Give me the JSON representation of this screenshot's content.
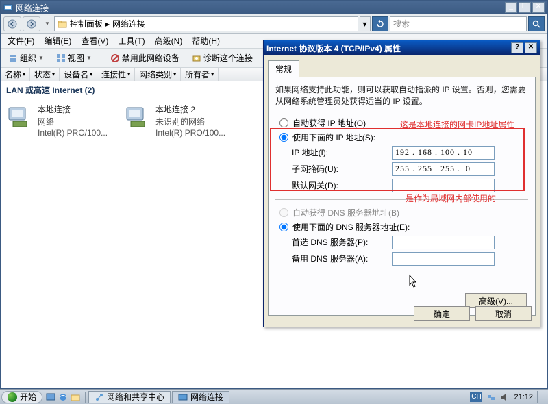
{
  "window": {
    "title": "网络连接",
    "breadcrumb_cp": "控制面板",
    "breadcrumb_nc": "网络连接",
    "search_placeholder": "搜索"
  },
  "menubar": {
    "file": "文件(F)",
    "edit": "编辑(E)",
    "view": "查看(V)",
    "tools": "工具(T)",
    "advanced": "高级(N)",
    "help": "帮助(H)"
  },
  "toolbar": {
    "organize": "组织",
    "views": "视图",
    "disable": "禁用此网络设备",
    "diagnose": "诊断这个连接"
  },
  "columns": [
    "名称",
    "状态",
    "设备名",
    "连接性",
    "网络类别",
    "所有者"
  ],
  "group_label": "LAN 或高速 Internet (2)",
  "connections": [
    {
      "name": "本地连接",
      "sub1": "网络",
      "sub2": "Intel(R) PRO/100..."
    },
    {
      "name": "本地连接 2",
      "sub1": "未识别的网络",
      "sub2": "Intel(R) PRO/100..."
    }
  ],
  "dialog": {
    "title": "Internet 协议版本 4 (TCP/IPv4) 属性",
    "tab_general": "常规",
    "desc": "如果网络支持此功能，则可以获取自动指派的 IP 设置。否则，您需要从网络系统管理员处获得适当的 IP 设置。",
    "radio_auto_ip": "自动获得 IP 地址(O)",
    "radio_manual_ip": "使用下面的 IP 地址(S):",
    "label_ip": "IP 地址(I):",
    "label_mask": "子网掩码(U):",
    "label_gw": "默认网关(D):",
    "val_ip": "192 . 168 . 100 . 10",
    "val_mask": "255 . 255 . 255 .  0",
    "val_gw": "",
    "radio_auto_dns": "自动获得 DNS 服务器地址(B)",
    "radio_manual_dns": "使用下面的 DNS 服务器地址(E):",
    "label_dns1": "首选 DNS 服务器(P):",
    "label_dns2": "备用 DNS 服务器(A):",
    "val_dns1": "",
    "val_dns2": "",
    "btn_adv": "高级(V)...",
    "btn_ok": "确定",
    "btn_cancel": "取消",
    "annotation1": "这是本地连接的网卡IP地址属性",
    "annotation2": "是作为局域网内部使用的"
  },
  "taskbar": {
    "start": "开始",
    "task1": "网络和共享中心",
    "task2": "网络连接",
    "lang": "CH",
    "clock": "21:12"
  }
}
